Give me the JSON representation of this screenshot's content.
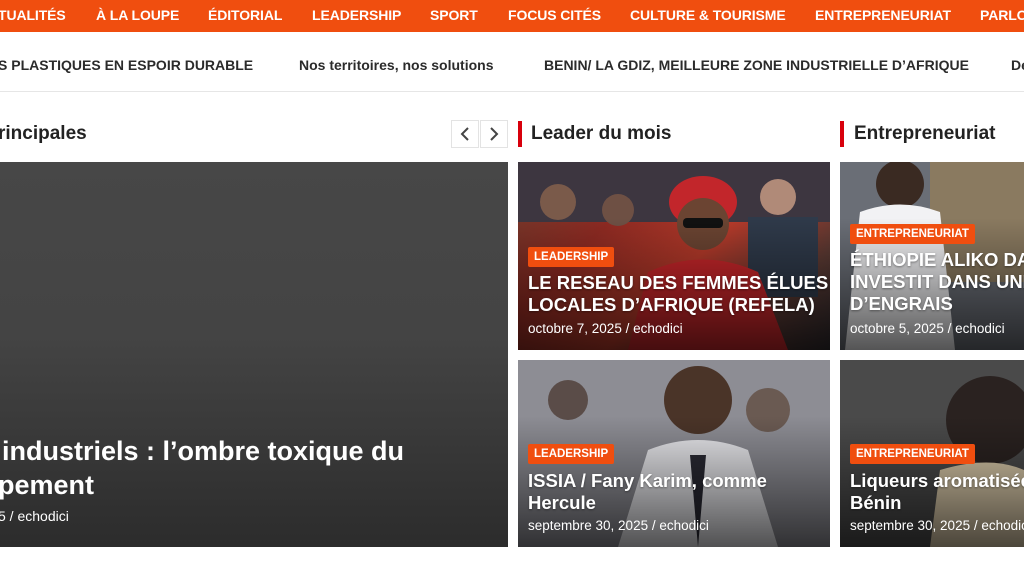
{
  "nav": {
    "items": [
      "TUALITÉS",
      "À LA LOUPE",
      "ÉDITORIAL",
      "LEADERSHIP",
      "SPORT",
      "FOCUS CITÉS",
      "CULTURE & TOURISME",
      "ENTREPRENEURIAT",
      "PARLO"
    ]
  },
  "ticker": {
    "items": [
      "S PLASTIQUES EN ESPOIR DURABLE",
      "Nos territoires, nos solutions",
      "BENIN/ LA GDIZ, MEILLEURE ZONE INDUSTRIELLE D’AFRIQUE",
      "De"
    ]
  },
  "sections": {
    "main": {
      "title": "rincipales"
    },
    "leader": {
      "title": "Leader du mois"
    },
    "entrepreneuriat": {
      "title": "Entrepreneuriat"
    }
  },
  "main_article": {
    "title_line1": "industriels : l’ombre toxique du",
    "title_line2": "pement",
    "meta": "5 / echodici"
  },
  "leader_cards": [
    {
      "badge": "LEADERSHIP",
      "title_line1": "LE RESEAU DES FEMMES ÉLUES",
      "title_line2": "LOCALES D’AFRIQUE (REFELA)",
      "meta": "octobre 7, 2025 / echodici"
    },
    {
      "badge": "LEADERSHIP",
      "title_line1": "ISSIA / Fany Karim, comme",
      "title_line2": "Hercule",
      "meta": "septembre 30, 2025 / echodici"
    }
  ],
  "entrepreneuriat_cards": [
    {
      "badge": "ENTREPRENEURIAT",
      "title_line1": "ÉTHIOPIE ALIKO DAN",
      "title_line2": "INVESTIT DANS UNE",
      "title_line3": "D’ENGRAIS",
      "meta": "octobre 5, 2025 / echodici"
    },
    {
      "badge": "ENTREPRENEURIAT",
      "title_line1": "Liqueurs aromatisée",
      "title_line2": "Bénin",
      "meta": "septembre 30, 2025 / echodici"
    }
  ],
  "colors": {
    "accent": "#f04e0f",
    "section_bar": "#d8000c"
  },
  "icons": {
    "prev": "chevron-left-icon",
    "next": "chevron-right-icon"
  }
}
